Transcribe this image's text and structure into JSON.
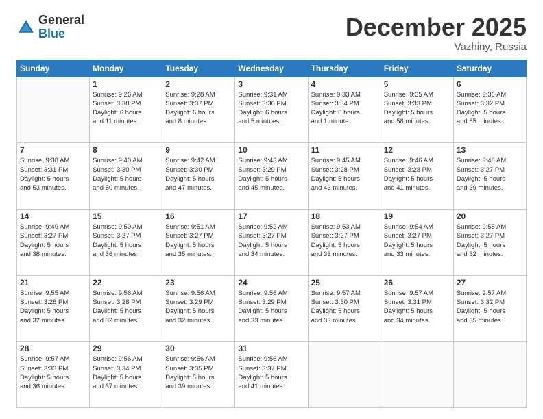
{
  "logo": {
    "general": "General",
    "blue": "Blue"
  },
  "header": {
    "month": "December 2025",
    "location": "Vazhiny, Russia"
  },
  "days": [
    "Sunday",
    "Monday",
    "Tuesday",
    "Wednesday",
    "Thursday",
    "Friday",
    "Saturday"
  ],
  "weeks": [
    [
      {
        "day": "",
        "content": ""
      },
      {
        "day": "1",
        "content": "Sunrise: 9:26 AM\nSunset: 3:38 PM\nDaylight: 6 hours\nand 11 minutes."
      },
      {
        "day": "2",
        "content": "Sunrise: 9:28 AM\nSunset: 3:37 PM\nDaylight: 6 hours\nand 8 minutes."
      },
      {
        "day": "3",
        "content": "Sunrise: 9:31 AM\nSunset: 3:36 PM\nDaylight: 6 hours\nand 5 minutes."
      },
      {
        "day": "4",
        "content": "Sunrise: 9:33 AM\nSunset: 3:34 PM\nDaylight: 6 hours\nand 1 minute."
      },
      {
        "day": "5",
        "content": "Sunrise: 9:35 AM\nSunset: 3:33 PM\nDaylight: 5 hours\nand 58 minutes."
      },
      {
        "day": "6",
        "content": "Sunrise: 9:36 AM\nSunset: 3:32 PM\nDaylight: 5 hours\nand 55 minutes."
      }
    ],
    [
      {
        "day": "7",
        "content": "Sunrise: 9:38 AM\nSunset: 3:31 PM\nDaylight: 5 hours\nand 53 minutes."
      },
      {
        "day": "8",
        "content": "Sunrise: 9:40 AM\nSunset: 3:30 PM\nDaylight: 5 hours\nand 50 minutes."
      },
      {
        "day": "9",
        "content": "Sunrise: 9:42 AM\nSunset: 3:30 PM\nDaylight: 5 hours\nand 47 minutes."
      },
      {
        "day": "10",
        "content": "Sunrise: 9:43 AM\nSunset: 3:29 PM\nDaylight: 5 hours\nand 45 minutes."
      },
      {
        "day": "11",
        "content": "Sunrise: 9:45 AM\nSunset: 3:28 PM\nDaylight: 5 hours\nand 43 minutes."
      },
      {
        "day": "12",
        "content": "Sunrise: 9:46 AM\nSunset: 3:28 PM\nDaylight: 5 hours\nand 41 minutes."
      },
      {
        "day": "13",
        "content": "Sunrise: 9:48 AM\nSunset: 3:27 PM\nDaylight: 5 hours\nand 39 minutes."
      }
    ],
    [
      {
        "day": "14",
        "content": "Sunrise: 9:49 AM\nSunset: 3:27 PM\nDaylight: 5 hours\nand 38 minutes."
      },
      {
        "day": "15",
        "content": "Sunrise: 9:50 AM\nSunset: 3:27 PM\nDaylight: 5 hours\nand 36 minutes."
      },
      {
        "day": "16",
        "content": "Sunrise: 9:51 AM\nSunset: 3:27 PM\nDaylight: 5 hours\nand 35 minutes."
      },
      {
        "day": "17",
        "content": "Sunrise: 9:52 AM\nSunset: 3:27 PM\nDaylight: 5 hours\nand 34 minutes."
      },
      {
        "day": "18",
        "content": "Sunrise: 9:53 AM\nSunset: 3:27 PM\nDaylight: 5 hours\nand 33 minutes."
      },
      {
        "day": "19",
        "content": "Sunrise: 9:54 AM\nSunset: 3:27 PM\nDaylight: 5 hours\nand 33 minutes."
      },
      {
        "day": "20",
        "content": "Sunrise: 9:55 AM\nSunset: 3:27 PM\nDaylight: 5 hours\nand 32 minutes."
      }
    ],
    [
      {
        "day": "21",
        "content": "Sunrise: 9:55 AM\nSunset: 3:28 PM\nDaylight: 5 hours\nand 32 minutes."
      },
      {
        "day": "22",
        "content": "Sunrise: 9:56 AM\nSunset: 3:28 PM\nDaylight: 5 hours\nand 32 minutes."
      },
      {
        "day": "23",
        "content": "Sunrise: 9:56 AM\nSunset: 3:29 PM\nDaylight: 5 hours\nand 32 minutes."
      },
      {
        "day": "24",
        "content": "Sunrise: 9:56 AM\nSunset: 3:29 PM\nDaylight: 5 hours\nand 33 minutes."
      },
      {
        "day": "25",
        "content": "Sunrise: 9:57 AM\nSunset: 3:30 PM\nDaylight: 5 hours\nand 33 minutes."
      },
      {
        "day": "26",
        "content": "Sunrise: 9:57 AM\nSunset: 3:31 PM\nDaylight: 5 hours\nand 34 minutes."
      },
      {
        "day": "27",
        "content": "Sunrise: 9:57 AM\nSunset: 3:32 PM\nDaylight: 5 hours\nand 35 minutes."
      }
    ],
    [
      {
        "day": "28",
        "content": "Sunrise: 9:57 AM\nSunset: 3:33 PM\nDaylight: 5 hours\nand 36 minutes."
      },
      {
        "day": "29",
        "content": "Sunrise: 9:56 AM\nSunset: 3:34 PM\nDaylight: 5 hours\nand 37 minutes."
      },
      {
        "day": "30",
        "content": "Sunrise: 9:56 AM\nSunset: 3:35 PM\nDaylight: 5 hours\nand 39 minutes."
      },
      {
        "day": "31",
        "content": "Sunrise: 9:56 AM\nSunset: 3:37 PM\nDaylight: 5 hours\nand 41 minutes."
      },
      {
        "day": "",
        "content": ""
      },
      {
        "day": "",
        "content": ""
      },
      {
        "day": "",
        "content": ""
      }
    ]
  ]
}
